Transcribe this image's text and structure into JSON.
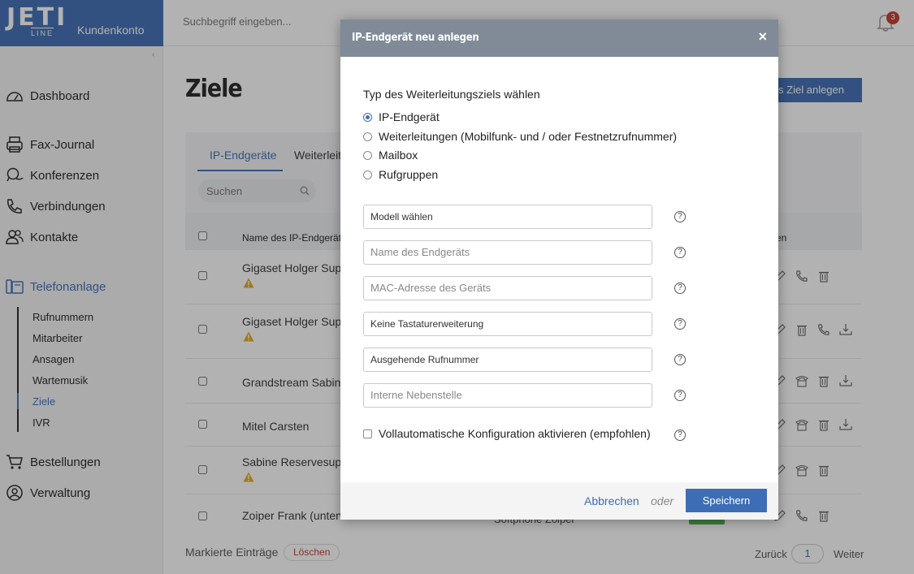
{
  "brand": {
    "logo": "JETI",
    "logo_sub": "LINE",
    "account": "Kundenkonto"
  },
  "top": {
    "search_placeholder": "Suchbegriff eingeben...",
    "notifications": "3"
  },
  "sidebar": {
    "items": [
      {
        "label": "Dashboard",
        "icon": "speedometer-icon"
      },
      {
        "label": "Fax-Journal",
        "icon": "fax-icon"
      },
      {
        "label": "Konferenzen",
        "icon": "chat-icon"
      },
      {
        "label": "Verbindungen",
        "icon": "phone-icon"
      },
      {
        "label": "Kontakte",
        "icon": "contacts-icon"
      },
      {
        "label": "Telefonanlage",
        "icon": "pbx-icon"
      },
      {
        "label": "Bestellungen",
        "icon": "cart-icon"
      },
      {
        "label": "Verwaltung",
        "icon": "user-circle-icon"
      }
    ],
    "sub_items": [
      "Rufnummern",
      "Mitarbeiter",
      "Ansagen",
      "Wartemusik",
      "Ziele",
      "IVR"
    ]
  },
  "main": {
    "title": "Ziele",
    "new_button": "es Ziel anlegen",
    "tabs": [
      "IP-Endgeräte",
      "Weiterleit"
    ],
    "search_placeholder": "Suchen",
    "col_name": "Name des IP-Endgeräts",
    "col_actions": "en",
    "rows": [
      {
        "name": "Gigaset Holger Suppo",
        "warning": true
      },
      {
        "name": "Gigaset Holger Suppo",
        "warning": true
      },
      {
        "name": "Grandstream Sabine",
        "warning": false
      },
      {
        "name": "Mitel Carsten",
        "warning": false
      },
      {
        "name": "Sabine Reservesuppo",
        "warning": true
      },
      {
        "name": "Zoiper Frank (unterw",
        "warning": false
      }
    ],
    "row6_extra": "Softphone Zoiper",
    "marked_label": "Markierte Einträge",
    "delete_label": "Löschen",
    "pager": {
      "back": "Zurück",
      "page": "1",
      "next": "Weiter"
    }
  },
  "modal": {
    "title": "IP-Endgerät neu anlegen",
    "close": "×",
    "type_label": "Typ des Weiterleitungsziels wählen",
    "options": [
      {
        "label": "IP-Endgerät",
        "checked": true
      },
      {
        "label": "Weiterleitungen (Mobilfunk- und / oder Festnetzrufnummer)",
        "checked": false
      },
      {
        "label": "Mailbox",
        "checked": false
      },
      {
        "label": "Rufgruppen",
        "checked": false
      }
    ],
    "model_select": "Modell wählen",
    "name_placeholder": "Name des Endgeräts",
    "mac_placeholder": "MAC-Adresse des Geräts",
    "keyboard_select": "Keine Tastaturerweiterung",
    "outgoing_select": "Ausgehende Rufnummer",
    "extension_placeholder": "Interne Nebenstelle",
    "auto_config_label": "Vollautomatische Konfiguration aktivieren (empfohlen)",
    "help": "?",
    "cancel": "Abbrechen",
    "or": "oder",
    "save": "Speichern"
  },
  "colors": {
    "accent": "#3d6db5",
    "modal_header": "#808b97",
    "warning": "#e6a817",
    "badge": "#c0392b"
  }
}
